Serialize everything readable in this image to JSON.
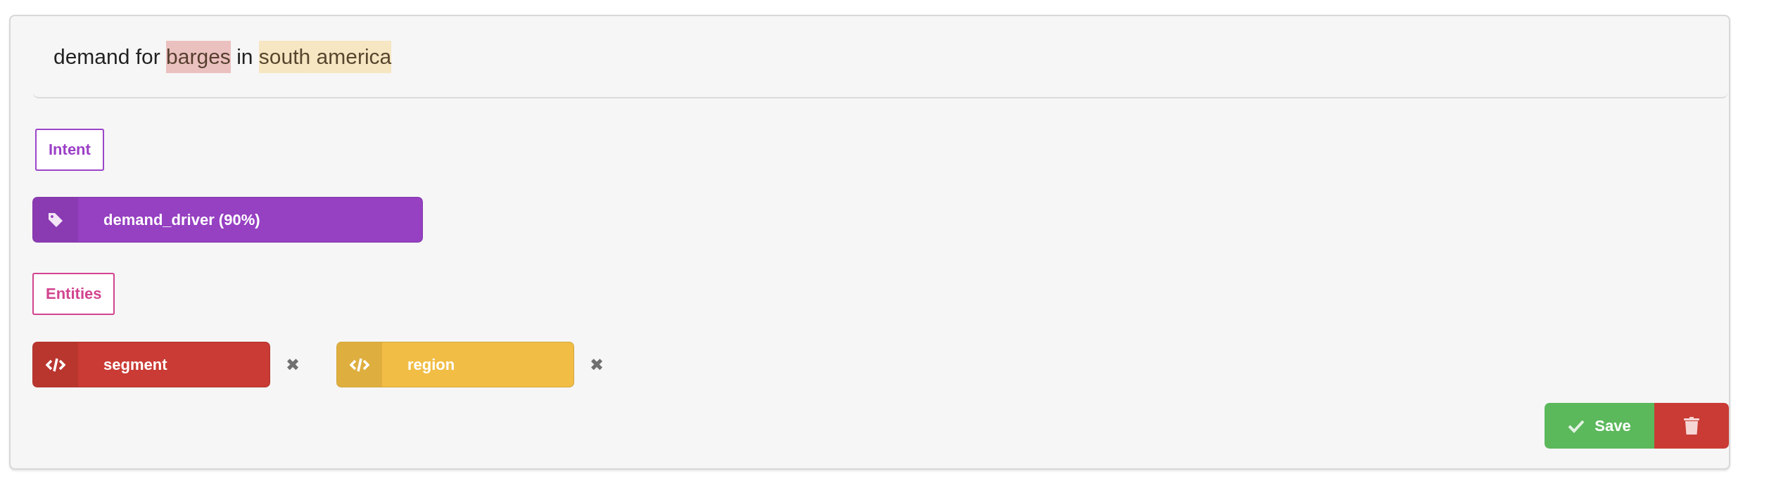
{
  "sentence": [
    {
      "text": "demand for "
    },
    {
      "text": "barges",
      "color": "#ebc1c0"
    },
    {
      "text": " in "
    },
    {
      "text": "south america",
      "color": "#f6e6c2"
    }
  ],
  "intent_heading": "Intent",
  "intent": {
    "label": "demand_driver (90%)",
    "color": "#9640c2"
  },
  "entities_heading": "Entities",
  "entities": [
    {
      "name": "segment",
      "color": "#c93b34"
    },
    {
      "name": "region",
      "color": "#f1bd45"
    }
  ],
  "remove_glyph": "✖",
  "save_button": "Save"
}
